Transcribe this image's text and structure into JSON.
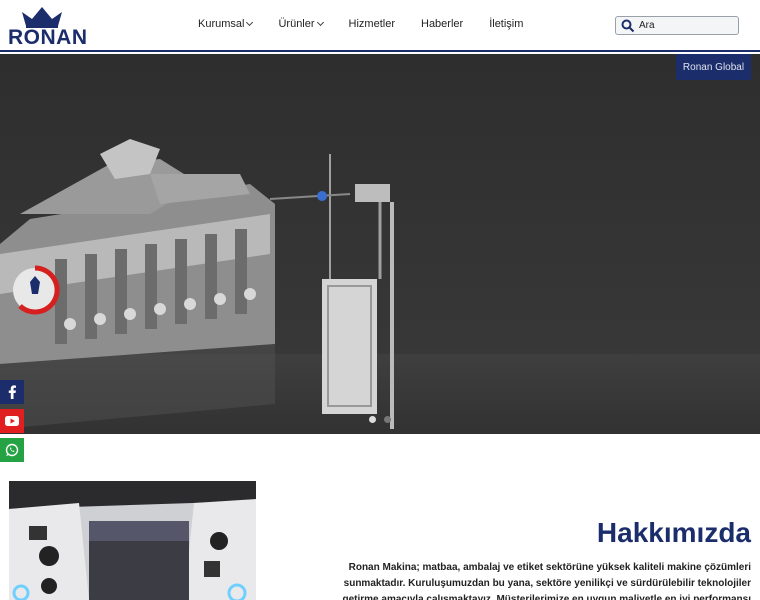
{
  "logo": {
    "text": "RONAN"
  },
  "nav": {
    "items": [
      {
        "label": "Kurumsal",
        "dropdown": true
      },
      {
        "label": "Ürünler",
        "dropdown": true
      },
      {
        "label": "Hizmetler",
        "dropdown": false
      },
      {
        "label": "Haberler",
        "dropdown": false
      },
      {
        "label": "İletişim",
        "dropdown": false
      }
    ]
  },
  "search": {
    "placeholder": "Ara",
    "icon": "search-icon"
  },
  "hero": {
    "global_button": "Ronan Global",
    "slide_count": 2,
    "active_slide": 1
  },
  "social": {
    "icons": [
      "facebook-icon",
      "youtube-icon",
      "whatsapp-icon"
    ]
  },
  "about": {
    "title": "Hakkımızda",
    "text": "Ronan Makina; matbaa, ambalaj ve etiket sektörüne yüksek kaliteli makine çözümleri sunmaktadır. Kuruluşumuzdan bu yana, sektöre yenilikçi ve sürdürülebilir teknolojiler getirme amacıyla çalışmaktayız. Müşterilerimize en uygun maliyetle en iyi performansı sunmayı ilke"
  },
  "colors": {
    "brand": "#1c2d6b",
    "youtube": "#e02020",
    "whatsapp": "#25a244"
  }
}
